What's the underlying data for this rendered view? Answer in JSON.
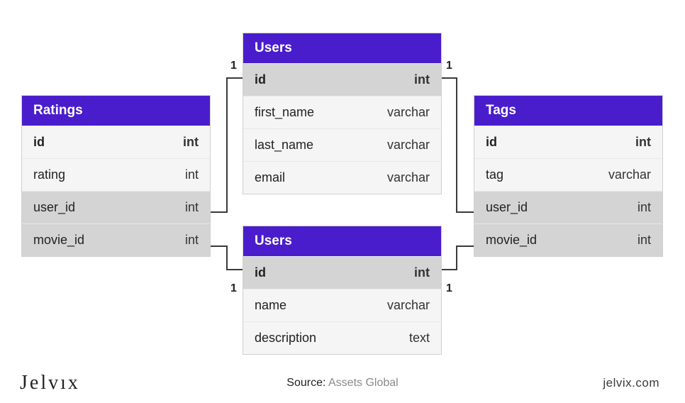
{
  "colors": {
    "accent": "#4a1dcc",
    "row_light": "#f5f5f5",
    "row_dark": "#d4d4d4"
  },
  "tables": {
    "ratings": {
      "title": "Ratings",
      "rows": [
        {
          "name": "id",
          "type": "int",
          "shade": "light",
          "bold": true
        },
        {
          "name": "rating",
          "type": "int",
          "shade": "light"
        },
        {
          "name": "user_id",
          "type": "int",
          "shade": "dark"
        },
        {
          "name": "movie_id",
          "type": "int",
          "shade": "dark"
        }
      ]
    },
    "users_top": {
      "title": "Users",
      "rows": [
        {
          "name": "id",
          "type": "int",
          "shade": "dark",
          "bold": true
        },
        {
          "name": "first_name",
          "type": "varchar",
          "shade": "light"
        },
        {
          "name": "last_name",
          "type": "varchar",
          "shade": "light"
        },
        {
          "name": "email",
          "type": "varchar",
          "shade": "light"
        }
      ]
    },
    "users_bottom": {
      "title": "Users",
      "rows": [
        {
          "name": "id",
          "type": "int",
          "shade": "dark",
          "bold": true
        },
        {
          "name": "name",
          "type": "varchar",
          "shade": "light"
        },
        {
          "name": "description",
          "type": "text",
          "shade": "light"
        }
      ]
    },
    "tags": {
      "title": "Tags",
      "rows": [
        {
          "name": "id",
          "type": "int",
          "shade": "light",
          "bold": true
        },
        {
          "name": "tag",
          "type": "varchar",
          "shade": "light"
        },
        {
          "name": "user_id",
          "type": "int",
          "shade": "dark"
        },
        {
          "name": "movie_id",
          "type": "int",
          "shade": "dark"
        }
      ]
    }
  },
  "cardinality": {
    "users_top_left": "1",
    "users_top_right": "1",
    "users_bottom_left": "1",
    "users_bottom_right": "1"
  },
  "footer": {
    "logo": "Jelvıx",
    "source_label": "Source:",
    "source_value": "Assets Global",
    "site": "jelvix.com"
  }
}
